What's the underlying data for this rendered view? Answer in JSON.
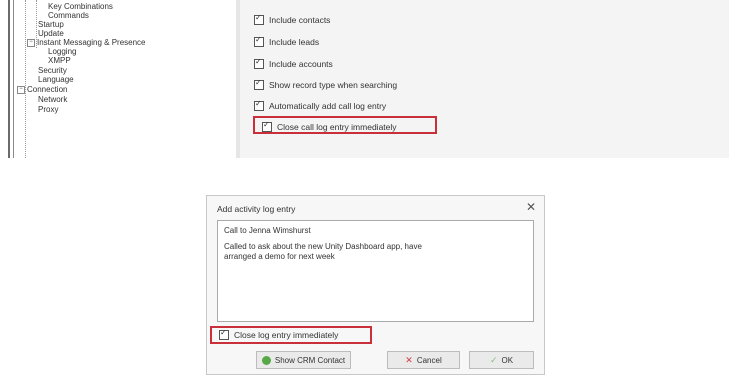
{
  "settings_tree": [
    {
      "label": "Key Combinations",
      "indent": 3
    },
    {
      "label": "Commands",
      "indent": 3
    },
    {
      "label": "Startup",
      "indent": 2
    },
    {
      "label": "Update",
      "indent": 2
    },
    {
      "label": "Instant Messaging & Presence",
      "indent": 2,
      "expander": "−"
    },
    {
      "label": "Logging",
      "indent": 3
    },
    {
      "label": "XMPP",
      "indent": 3
    },
    {
      "label": "Security",
      "indent": 2
    },
    {
      "label": "Language",
      "indent": 2
    },
    {
      "label": "Connection",
      "indent": 1,
      "expander": "−"
    },
    {
      "label": "Network",
      "indent": 2
    },
    {
      "label": "Proxy",
      "indent": 2
    }
  ],
  "settings_options": [
    {
      "label": "Include contacts",
      "checked": true
    },
    {
      "label": "Include leads",
      "checked": true
    },
    {
      "label": "Include accounts",
      "checked": true
    },
    {
      "label": "Show record type when searching",
      "checked": true
    },
    {
      "label": "Automatically add call log entry",
      "checked": true
    },
    {
      "label": "Close call log entry immediately",
      "checked": true
    }
  ],
  "dialog": {
    "title": "Add activity log entry",
    "close_symbol": "✕",
    "text_line1": "Call to Jenna Wimshurst",
    "text_line2": "Called to ask about the new Unity Dashboard app, have",
    "text_line3": "arranged a demo for next week",
    "close_immediately_label": "Close log entry immediately",
    "close_immediately_checked": true,
    "buttons": {
      "crm": "Show CRM Contact",
      "cancel": "Cancel",
      "ok": "OK"
    },
    "icons": {
      "crm": "crm-icon",
      "cancel": "x-icon",
      "ok": "check-icon"
    }
  },
  "colors": {
    "highlight": "#c9303a",
    "crm_icon": "#57a846"
  }
}
